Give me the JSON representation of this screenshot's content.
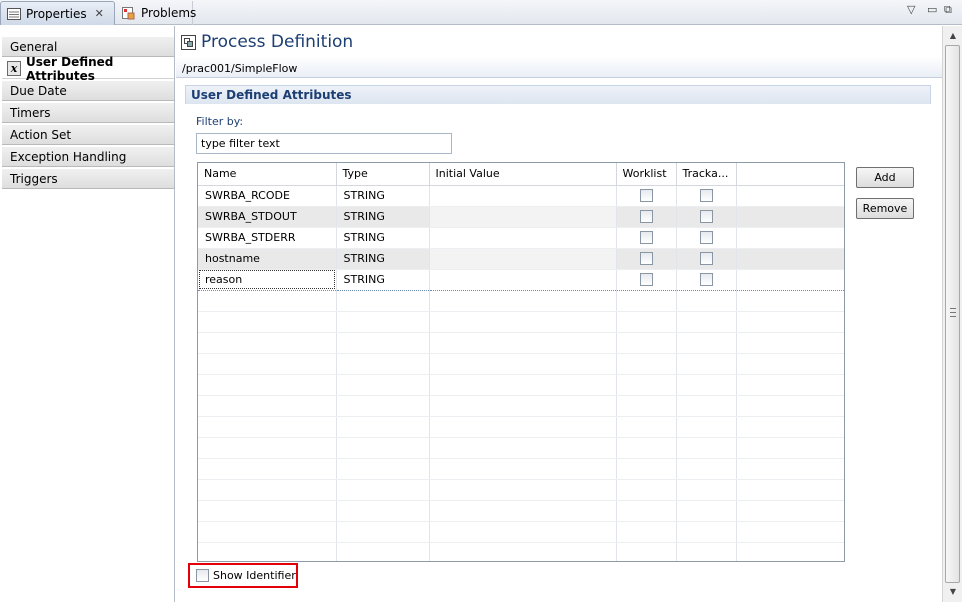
{
  "tabs": [
    {
      "label": "Properties",
      "icon": "properties-icon",
      "active": true
    },
    {
      "label": "Problems",
      "icon": "problems-icon",
      "active": false
    }
  ],
  "nav": {
    "items": [
      {
        "label": "General",
        "selected": false
      },
      {
        "label": "User Defined Attributes",
        "selected": true
      },
      {
        "label": "Due Date",
        "selected": false
      },
      {
        "label": "Timers",
        "selected": false
      },
      {
        "label": "Action Set",
        "selected": false
      },
      {
        "label": "Exception Handling",
        "selected": false
      },
      {
        "label": "Triggers",
        "selected": false
      }
    ]
  },
  "header": {
    "title": "Process Definition",
    "path": "/prac001/SimpleFlow"
  },
  "section": {
    "title": "User Defined Attributes"
  },
  "filter": {
    "label": "Filter by:",
    "value": "type filter text"
  },
  "table": {
    "columns": [
      "Name",
      "Type",
      "Initial Value",
      "Worklist",
      "Tracka..."
    ],
    "rows": [
      {
        "name": "SWRBA_RCODE",
        "type": "STRING",
        "initial_value": "",
        "worklist": false,
        "trackable": false
      },
      {
        "name": "SWRBA_STDOUT",
        "type": "STRING",
        "initial_value": "",
        "worklist": false,
        "trackable": false
      },
      {
        "name": "SWRBA_STDERR",
        "type": "STRING",
        "initial_value": "",
        "worklist": false,
        "trackable": false
      },
      {
        "name": "hostname",
        "type": "STRING",
        "initial_value": "",
        "worklist": false,
        "trackable": false
      },
      {
        "name": "reason",
        "type": "STRING",
        "initial_value": "",
        "worklist": false,
        "trackable": false
      }
    ],
    "selected_row": 4
  },
  "buttons": {
    "add": "Add",
    "remove": "Remove"
  },
  "show_identifier": {
    "label": "Show Identifier",
    "checked": false
  },
  "colors": {
    "title_blue": "#1c3e72",
    "highlight_red": "#e3000b"
  }
}
